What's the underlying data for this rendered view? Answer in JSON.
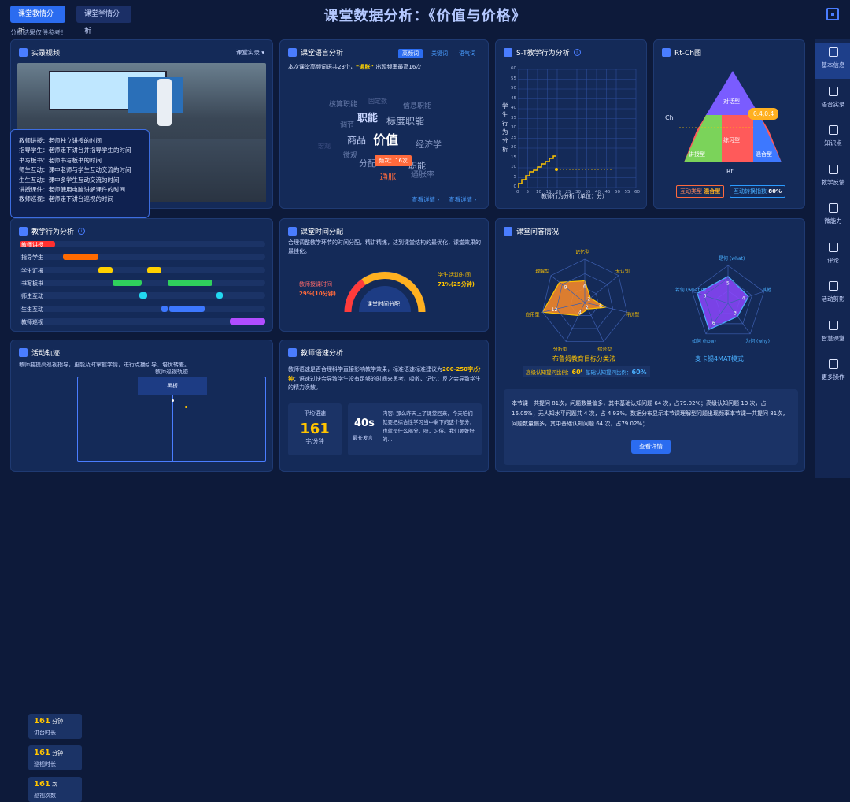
{
  "header": {
    "tab_active": "课堂教情分析",
    "tab_inactive": "课堂学情分析",
    "title": "课堂数据分析：《价值与价格》",
    "note": "分析结果仅供参考！"
  },
  "video": {
    "title": "实录视频",
    "dropdown": "课堂实录",
    "legend": [
      "教师讲授：老师独立讲授的时间",
      "指导学生：老师走下讲台并指导学生的时间",
      "书写板书：老师书写板书的时间",
      "师生互动：课中老师与学生互动交流的时间",
      "生生互动：课中多学生互动交流的时间",
      "讲授课件：老师使用电脑讲解课件的时间",
      "教师巡视：老师走下讲台巡视的时间"
    ]
  },
  "language": {
    "title": "课堂语言分析",
    "tabs": [
      "高频词",
      "关键词",
      "语气词"
    ],
    "summary_pre": "本次课堂高频词语共23个，",
    "summary_word": "“通胀”",
    "summary_post": "出现频率最高16次",
    "words": [
      "核算职能",
      "固定数",
      "信息职能",
      "调节",
      "职能",
      "标度职能",
      "商品",
      "价值",
      "经济学",
      "微观",
      "分配",
      "通胀",
      "通胀率",
      "职能",
      "宏观"
    ],
    "tooltip": "频次：16次",
    "link1": "查看详情",
    "link2": "查看详情"
  },
  "st": {
    "title": "S-T教学行为分析",
    "ylabel": "学生行为分析",
    "xlabel": "教师行为分析（单位：分）",
    "yticks": [
      "60",
      "55",
      "50",
      "45",
      "40",
      "35",
      "30",
      "25",
      "20",
      "15",
      "10",
      "5",
      "0"
    ],
    "xticks": [
      "0",
      "5",
      "10",
      "15",
      "20",
      "25",
      "30",
      "35",
      "40",
      "45",
      "50",
      "55",
      "60"
    ]
  },
  "rtch": {
    "title": "Rt-Ch图",
    "ch": "Ch",
    "rt": "Rt",
    "zones": [
      "对话型",
      "练习型",
      "讲授型",
      "混合型"
    ],
    "point": "0.4,0.4",
    "badge1_label": "互动类型",
    "badge1_value": "混合型",
    "badge2_label": "互动转换指数",
    "badge2_value": "80%"
  },
  "behavior": {
    "title": "教学行为分析",
    "rows": [
      "教师讲授",
      "指导学生",
      "学生汇报",
      "书写板书",
      "师生互动",
      "生生互动",
      "教师巡视"
    ]
  },
  "time": {
    "title": "课堂时间分配",
    "desc": "合理调整教学环节的时间分配，精讲精练，达到课堂结构的最优化，课堂效果的最佳化。",
    "teacher_label": "教师授课时间",
    "teacher_value": "29%(10分钟)",
    "student_label": "学生活动时间",
    "student_value": "71%(25分钟)",
    "center": "课堂时间分配"
  },
  "qa": {
    "title": "课堂问答情况",
    "radar1_labels": [
      "记忆型",
      "无认知",
      "评价型",
      "综合型",
      "分析型",
      "应用型",
      "理解型"
    ],
    "radar1_values": [
      "6",
      "2",
      "6",
      "2",
      "4",
      "12",
      "9"
    ],
    "radar1_caption": "布鲁姆教育目标分类法",
    "radar1_badge1": "高级认知提问比例：",
    "radar1_badge1_val": "60%",
    "radar1_badge2": "基础认知提问比例：",
    "radar1_badge2_val": "60%",
    "radar2_labels": [
      "是何 (what)",
      "其他",
      "为何 (why)",
      "如何 (how)",
      "若何 (what if)"
    ],
    "radar2_values": [
      "5",
      "4",
      "3",
      "6",
      "6"
    ],
    "radar2_caption": "麦卡锡4MAT模式",
    "summary": "本节课一共提问 81次，问题数量偏多，其中基础认知问题 64 次，占79.02%；高级认知问题 13 次，占 16.05%；无人知水平问题共 4 次，占 4.93%。数据分布显示本节课理解型问题出现频率本节课一共提问 81次，问题数量偏多，其中基础认知问题 64 次，占79.02%；...",
    "button": "查看详情"
  },
  "track": {
    "title": "活动轨迹",
    "desc": "教师要提高巡视指导，更能及时掌握学情，进行点播引导、培优转差。",
    "stats": [
      {
        "num": "161",
        "unit": "分钟",
        "label": "讲台时长"
      },
      {
        "num": "161",
        "unit": "分钟",
        "label": "巡视时长"
      },
      {
        "num": "161",
        "unit": "次",
        "label": "巡视次数"
      }
    ],
    "map_title": "教师巡视轨迹",
    "map_label": "黑板"
  },
  "speed": {
    "title": "教师语速分析",
    "desc_pre": "教师语速是否合理科学直接影响教学效果，标准语速标准建议为",
    "desc_hi": "200-250字/分钟",
    "desc_post": "；语速过快会导致学生没有足够的时间来思考、吸收、记忆；反之会导致学生的精力涣散。",
    "avg_label": "平均语速",
    "avg_value": "161",
    "avg_unit": "字/分钟",
    "long_value": "40s",
    "long_label": "最长发言",
    "quote": "内容: 那么昨天上了课堂回来，今天咱们就要把综合性学习当中剩下的这个部分，也就是什么部分，呀，习俗。我们要好好的..."
  },
  "sidebar": [
    "基本信息",
    "语音实录",
    "知识点",
    "教学反馈",
    "微能力",
    "评论",
    "活动剪影",
    "智慧课堂",
    "更多操作"
  ],
  "colors": {
    "accent": "#2b6cf0",
    "orange": "#ff8a00",
    "yellow": "#ffc400",
    "green": "#2fd05c",
    "cyan": "#22d8f0",
    "blue": "#3d78ff",
    "purple": "#b14dff",
    "red": "#ff3030"
  }
}
